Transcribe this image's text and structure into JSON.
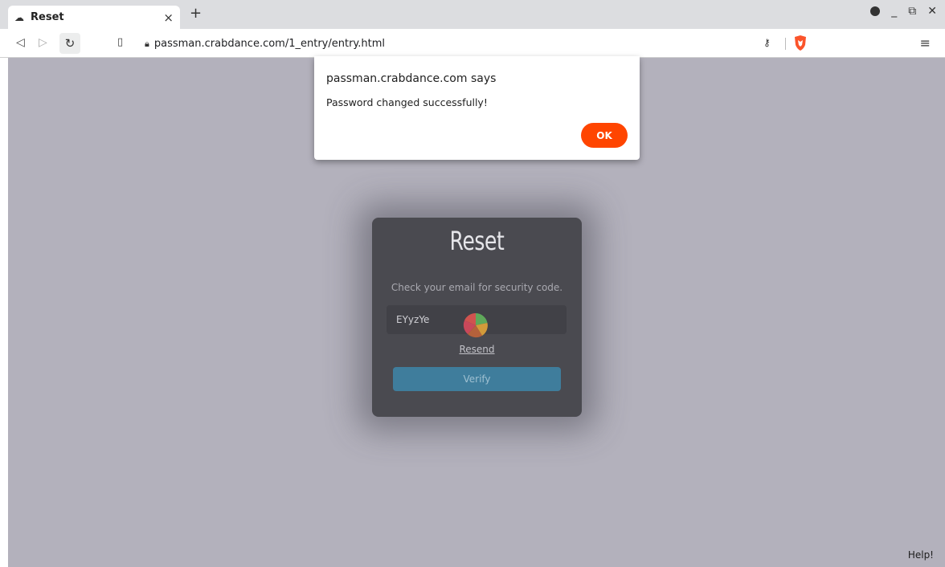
{
  "browser": {
    "tab_title": "Reset",
    "tab_close": "×",
    "new_tab": "+",
    "url": "passman.crabdance.com/1_entry/entry.html"
  },
  "card": {
    "title": "Reset",
    "hint": "Check your email for security code.",
    "code_value": "EYyzYe",
    "resend_label": "Resend",
    "verify_label": "Verify"
  },
  "alert": {
    "origin": "passman.crabdance.com says",
    "message": "Password changed successfully!",
    "ok_label": "OK"
  },
  "help_label": "Help!",
  "colors": {
    "page_bg": "#b3b1bc",
    "card_bg": "#4a4a50",
    "verify_bg": "#3f7d9c",
    "ok_bg": "#ff4500"
  },
  "icons": {
    "tab": "cloud-icon",
    "back": "back-arrow-icon",
    "forward": "forward-arrow-icon",
    "reload": "reload-icon",
    "bookmark": "bookmark-icon",
    "lock": "lock-icon",
    "key": "key-icon",
    "brave": "brave-shield-icon",
    "menu": "hamburger-menu-icon",
    "spinner": "loading-spinner-icon"
  }
}
